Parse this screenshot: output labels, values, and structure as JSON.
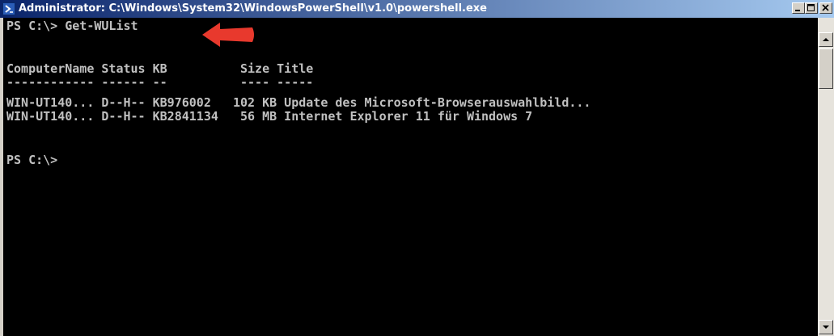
{
  "window": {
    "title": "Administrator: C:\\Windows\\System32\\WindowsPowerShell\\v1.0\\powershell.exe",
    "icon": "powershell-icon"
  },
  "console": {
    "lines": [
      "PS C:\\> Get-WUList",
      "",
      "ComputerName Status KB          Size Title",
      "------------ ------ --          ---- -----",
      "WIN-UT140... D--H-- KB976002   102 KB Update des Microsoft-Browserauswahlbild...",
      "WIN-UT140... D--H-- KB2841134   56 MB Internet Explorer 11 für Windows 7",
      "",
      "",
      "PS C:\\>"
    ],
    "text_color": "#c0c0c0",
    "background_color": "#000000"
  },
  "annotation": {
    "arrow_color": "#e8392d",
    "icon": "red-arrow-icon"
  }
}
